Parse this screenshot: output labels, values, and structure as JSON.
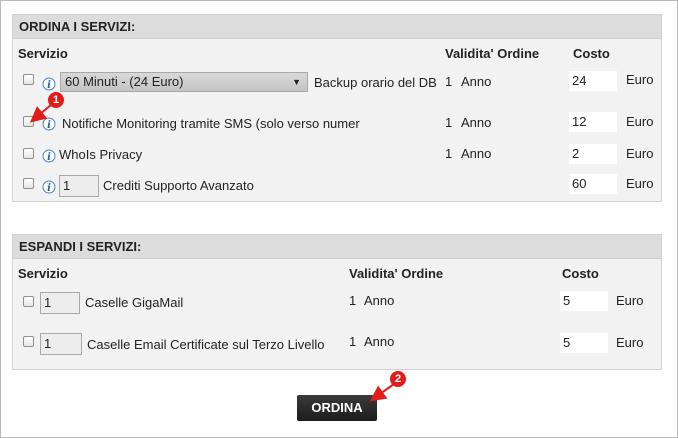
{
  "order": {
    "heading": "ORDINA I SERVIZI:",
    "col_service": "Servizio",
    "col_validity": "Validita' Ordine",
    "col_cost": "Costo",
    "rows": [
      {
        "select_value": "60 Minuti - (24 Euro)",
        "label": "Backup orario del DB",
        "qty_value": "1",
        "unit": "Anno",
        "cost": "24",
        "currency": "Euro"
      },
      {
        "label": "Notifiche Monitoring tramite SMS (solo verso numer",
        "qty_value": "1",
        "unit": "Anno",
        "cost": "12",
        "currency": "Euro"
      },
      {
        "label": "WhoIs Privacy",
        "qty_value": "1",
        "unit": "Anno",
        "cost": "2",
        "currency": "Euro"
      },
      {
        "quantity": "1",
        "label": "Crediti Supporto Avanzato",
        "cost": "60",
        "currency": "Euro"
      }
    ]
  },
  "expand": {
    "heading": "ESPANDI I SERVIZI:",
    "col_service": "Servizio",
    "col_validity": "Validita' Ordine",
    "col_cost": "Costo",
    "rows": [
      {
        "quantity": "1",
        "label": "Caselle  GigaMail",
        "qty_value": "1",
        "unit": "Anno",
        "cost": "5",
        "currency": "Euro"
      },
      {
        "quantity": "1",
        "label": "Caselle  Email Certificate sul Terzo Livello",
        "qty_value": "1",
        "unit": "Anno",
        "cost": "5",
        "currency": "Euro"
      }
    ]
  },
  "submit_label": "ORDINA",
  "annotations": {
    "marker1": "1",
    "marker2": "2",
    "marker_color": "#e21b1b"
  },
  "icons": {
    "info": "info-icon",
    "select_arrow": "chevron-down-icon"
  }
}
